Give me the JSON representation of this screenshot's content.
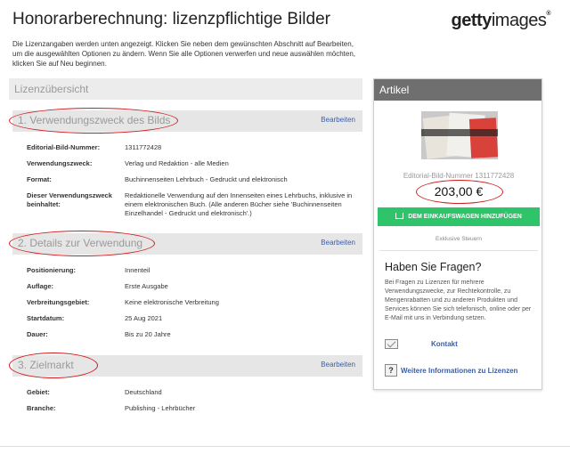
{
  "header": {
    "title": "Honorarberechnung: lizenzpflichtige Bilder",
    "logo_bold": "getty",
    "logo_light": "images",
    "logo_mark": "®"
  },
  "intro": "Die Lizenzangaben werden unten angezeigt. Klicken Sie neben dem gewünschten Abschnitt auf Bearbeiten, um die ausgewählten Optionen zu ändern. Wenn Sie alle Optionen verwerfen und neue auswählen möchten, klicken Sie auf Neu beginnen.",
  "overview": {
    "title": "Lizenzübersicht"
  },
  "sections": [
    {
      "title": "1. Verwendungszweck des Bilds",
      "edit_label": "Bearbeiten",
      "rows": [
        {
          "key": "Editorial-Bild-Nummer:",
          "value": "1311772428"
        },
        {
          "key": "Verwendungszweck:",
          "value": "Verlag und Redaktion - alle Medien"
        },
        {
          "key": "Format:",
          "value": "Buchinnenseiten Lehrbuch - Gedruckt und elektronisch"
        },
        {
          "key": "Dieser Verwendungszweck beinhaltet:",
          "value": "Redaktionelle Verwendung auf den Innenseiten eines Lehrbuchs, inklusive in einem elektronischen Buch. (Alle anderen Bücher siehe 'Buchinnenseiten Einzelhandel - Gedruckt und elektronisch'.)"
        }
      ]
    },
    {
      "title": "2. Details zur Verwendung",
      "edit_label": "Bearbeiten",
      "rows": [
        {
          "key": "Positionierung:",
          "value": "Innenteil"
        },
        {
          "key": "Auflage:",
          "value": "Erste Ausgabe"
        },
        {
          "key": "Verbreitungsgebiet:",
          "value": "Keine elektronische Verbreitung"
        },
        {
          "key": "Startdatum:",
          "value": "25 Aug 2021"
        },
        {
          "key": "Dauer:",
          "value": "Bis zu 20 Jahre"
        }
      ]
    },
    {
      "title": "3. Zielmarkt",
      "edit_label": "Bearbeiten",
      "rows": [
        {
          "key": "Gebiet:",
          "value": "Deutschland"
        },
        {
          "key": "Branche:",
          "value": "Publishing - Lehrbücher"
        }
      ]
    }
  ],
  "sidebar": {
    "title": "Artikel",
    "image_id": "Editorial-Bild-Nummer 1311772428",
    "price": "203,00 €",
    "cart_button": "DEM EINKAUFSWAGEN HINZUFÜGEN",
    "tax_note": "Exklusive Steuern",
    "faq_title": "Haben Sie Fragen?",
    "faq_text": "Bei Fragen zu Lizenzen für mehrere Verwendungszwecke, zur Rechtekontrolle, zu Mengenrabatten und zu anderen Produkten und Services können Sie sich telefonisch, online oder per E-Mail mit uns in Verbindung setzen.",
    "contact_label": "Kontakt",
    "help_glyph": "?",
    "more_info_label": "Weitere Informationen zu Lizenzen"
  },
  "colors": {
    "accent_link": "#3b5ea8",
    "cart_green": "#2fc46a",
    "highlight_red": "#d01c1c",
    "sidebar_header": "#6f6f6f"
  }
}
